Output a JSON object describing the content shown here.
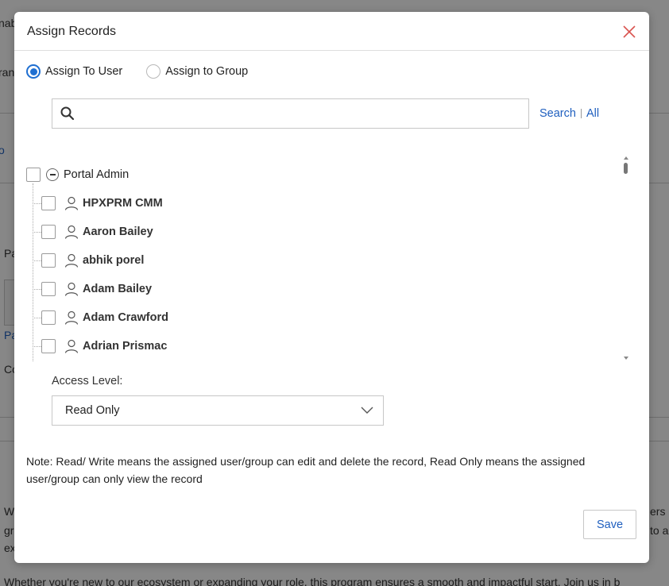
{
  "background": {
    "fragments": [
      "nab",
      "ran",
      "o",
      "Pa",
      "Pa",
      "Co",
      "W",
      "gr",
      "ex",
      "ers",
      "to al"
    ],
    "footer_text": "Whether you're new to our ecosystem or expanding your role, this program ensures a smooth and impactful start. Join us in b"
  },
  "modal": {
    "title": "Assign Records",
    "close_icon": "close-icon",
    "radios": [
      {
        "label": "Assign To User",
        "checked": true
      },
      {
        "label": "Assign to Group",
        "checked": false
      }
    ],
    "search": {
      "placeholder": "",
      "search_label": "Search",
      "all_label": "All",
      "icon": "search-icon"
    },
    "tree": {
      "root_label": "Portal Admin",
      "users": [
        "HPXPRM CMM",
        "Aaron Bailey",
        "abhik porel",
        "Adam Bailey",
        "Adam Crawford",
        "Adrian Prismac"
      ]
    },
    "access_level": {
      "label": "Access Level:",
      "value": "Read Only"
    },
    "note": "Note: Read/ Write means the assigned user/group can edit and delete the record, Read Only means the assigned user/group can only view the record",
    "save_label": "Save"
  },
  "colors": {
    "accent": "#1f6fd1",
    "link": "#1f5fbf",
    "close": "#d9534f"
  }
}
